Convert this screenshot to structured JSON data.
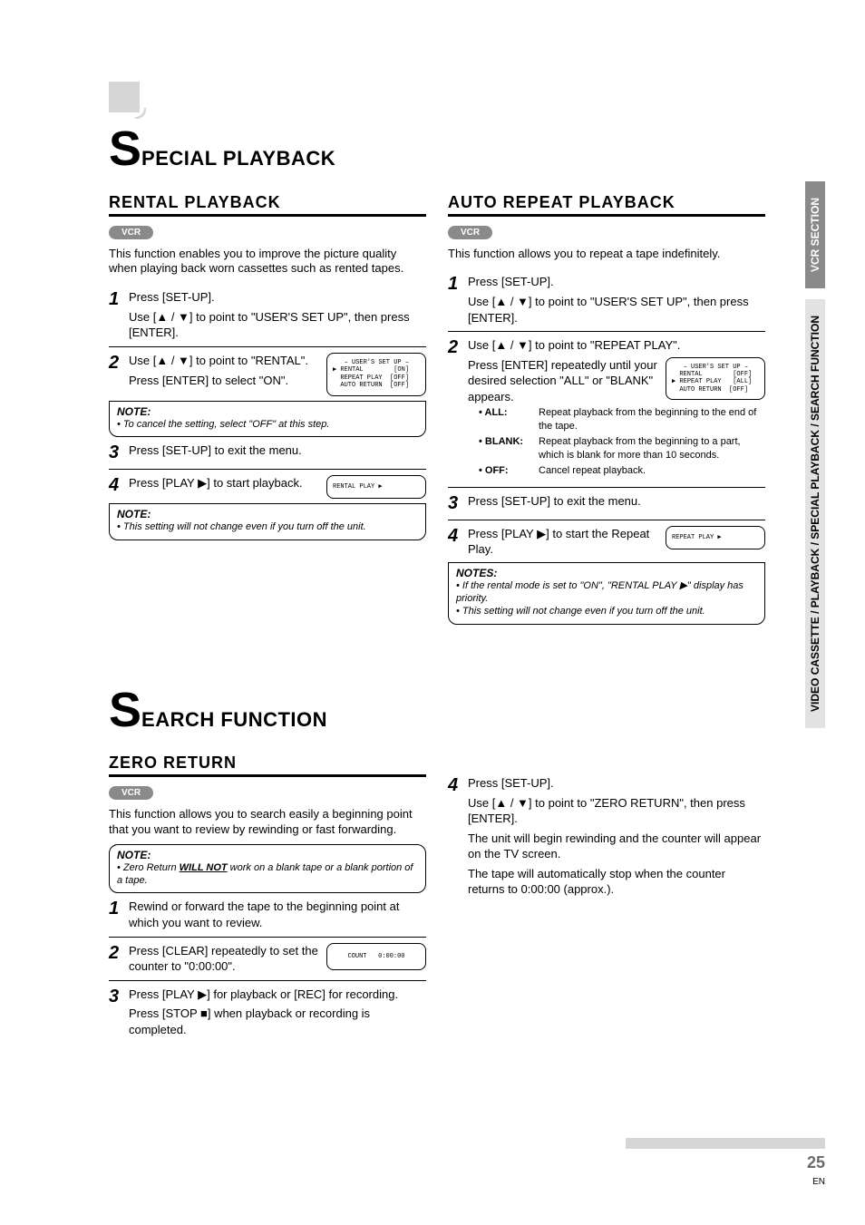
{
  "icons": {
    "top_icon": "page-corner-icon"
  },
  "side_tabs": {
    "top": "VCR SECTION",
    "bottom": "VIDEO CASSETTE / PLAYBACK / SPECIAL PLAYBACK / SEARCH FUNCTION"
  },
  "chapter1": {
    "big": "S",
    "rest": "PECIAL PLAYBACK"
  },
  "chapter2": {
    "big": "S",
    "rest": "EARCH FUNCTION"
  },
  "rental": {
    "title": "RENTAL PLAYBACK",
    "pill": "VCR",
    "intro": "This function enables you to improve the picture quality when playing back worn cassettes such as rented tapes.",
    "step1a": "Press [SET-UP].",
    "step1b": "Use [▲ / ▼] to point to \"USER'S SET UP\", then press [ENTER].",
    "step2a": "Use [▲ / ▼] to point to \"RENTAL\".",
    "step2b": "Press [ENTER] to select \"ON\".",
    "screen2": "   – USER'S SET UP –\n▶ RENTAL        [ON]\n  REPEAT PLAY  [OFF]\n  AUTO RETURN  [OFF]",
    "note1_title": "NOTE:",
    "note1_body": "• To cancel the setting, select \"OFF\" at this step.",
    "step3": "Press [SET-UP] to exit the menu.",
    "step4": "Press [PLAY ▶] to start playback.",
    "screen4": "RENTAL PLAY ▶",
    "note2_title": "NOTE:",
    "note2_body": "• This setting will not change even if you turn off the unit."
  },
  "repeat": {
    "title": "AUTO REPEAT PLAYBACK",
    "pill": "VCR",
    "intro": "This function allows you to repeat a tape indefinitely.",
    "step1a": "Press [SET-UP].",
    "step1b": "Use [▲ / ▼] to point to \"USER'S SET UP\", then press [ENTER].",
    "step2a": "Use [▲ / ▼] to point to \"REPEAT PLAY\".",
    "step2b": "Press [ENTER] repeatedly until your desired selection \"ALL\" or \"BLANK\" appears.",
    "screen2": "   – USER'S SET UP –\n  RENTAL        [OFF]\n▶ REPEAT PLAY   [ALL]\n  AUTO RETURN  [OFF]",
    "bul_all_label": "• ALL:",
    "bul_all": "Repeat playback from the beginning to the end of the tape.",
    "bul_blank_label": "• BLANK:",
    "bul_blank": "Repeat playback from the beginning to a part, which is blank for more than 10 seconds.",
    "bul_off_label": "• OFF:",
    "bul_off": "Cancel repeat playback.",
    "step3": "Press [SET-UP] to exit the menu.",
    "step4": "Press [PLAY ▶] to start the Repeat Play.",
    "screen4": "REPEAT PLAY ▶",
    "notes_title": "NOTES:",
    "notes_body1": "• If the rental mode is set to \"ON\", \"RENTAL PLAY ▶\" display has priority.",
    "notes_body2": "• This setting will not change even if you turn off the unit."
  },
  "zero": {
    "title": "ZERO RETURN",
    "pill": "VCR",
    "intro": "This function allows you to search easily a beginning point that you want to review by rewinding or fast forwarding.",
    "note_title": "NOTE:",
    "note_body_pre": "• Zero Return ",
    "note_body_u": "WILL NOT",
    "note_body_post": " work on a blank tape or a blank portion of a tape.",
    "step1": "Rewind or forward the tape to the beginning point at which you want to review.",
    "step2": "Press [CLEAR] repeatedly to set the counter to \"0:00:00\".",
    "screen2": "COUNT   0:00:00",
    "step3a": "Press [PLAY ▶] for playback or [REC] for recording.",
    "step3b": "Press [STOP ■] when playback or recording is completed.",
    "step4a": "Press [SET-UP].",
    "step4b": "Use [▲ / ▼] to point to \"ZERO RETURN\", then press [ENTER].",
    "step4c": "The unit will begin rewinding and the counter will appear on the TV screen.",
    "step4d": "The tape will automatically stop when the counter returns to 0:00:00 (approx.)."
  },
  "footer": {
    "num": "25",
    "en": "EN"
  }
}
